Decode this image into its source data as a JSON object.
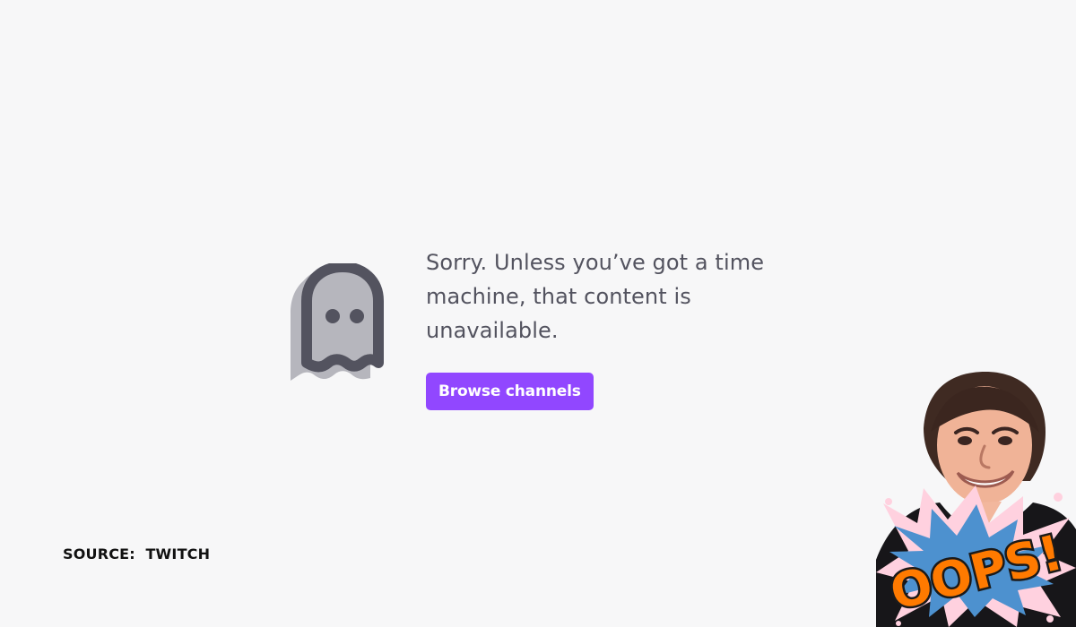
{
  "error_page": {
    "message": "Sorry. Unless you’ve got a time machine, that content is unavailable.",
    "browse_button_label": "Browse channels",
    "icon": "ghost-icon"
  },
  "caption": {
    "source": "SOURCE:  TWITCH"
  },
  "sticker": {
    "text": "OOPS!",
    "icon": "comic-burst-icon"
  },
  "colors": {
    "background": "#f7f7f8",
    "message_text": "#53535f",
    "button": "#9147ff",
    "ghost_outline": "#53535f",
    "ghost_fill": "#b6b6bd"
  }
}
